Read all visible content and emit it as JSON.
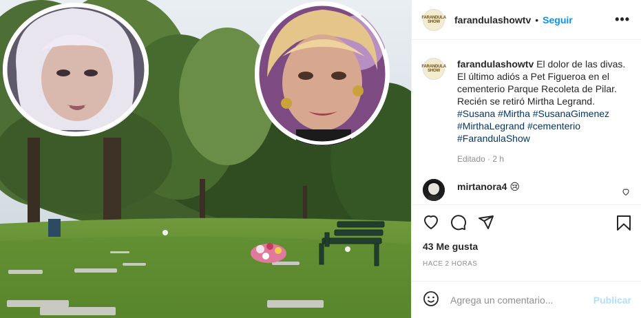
{
  "post": {
    "username": "farandulashowtv",
    "follow_label": "Seguir",
    "dot": "•",
    "more_label": "•••",
    "avatar_text": "FARANDULA SHOW"
  },
  "caption": {
    "username": "farandulashowtv",
    "text": "El dolor de las divas. El último adiós a Pet Figueroa en el cementerio Parque Recoleta de Pilar. Recién se retiró Mirtha Legrand.",
    "hashtags": [
      "#Susana",
      "#Mirtha",
      "#SusanaGimenez",
      "#MirthaLegrand",
      "#cementerio",
      "#FarandulaShow"
    ],
    "edited": "Editado · 2 h"
  },
  "comment": {
    "username": "mirtanora4",
    "emoji": "😢"
  },
  "stats": {
    "likes": "43 Me gusta",
    "time": "HACE 2 HORAS"
  },
  "add_comment": {
    "placeholder": "Agrega un comentario...",
    "publish_label": "Publicar"
  },
  "icons": {
    "like": "heart-icon",
    "comment": "comment-icon",
    "share": "share-icon",
    "save": "bookmark-icon",
    "emoji": "smiley-icon",
    "more": "more-options-icon"
  },
  "colors": {
    "accent": "#0095f6",
    "hashtag": "#00376b",
    "publish_disabled": "#b2dffc",
    "muted": "#8e8e8e"
  }
}
